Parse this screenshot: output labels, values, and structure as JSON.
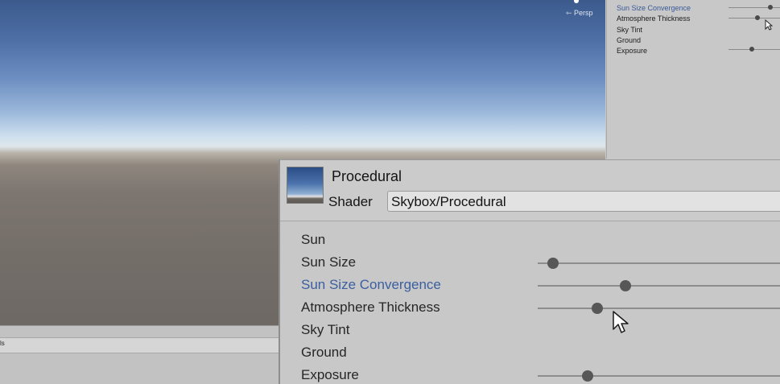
{
  "scene": {
    "persp_label": "⇽ Persp",
    "bottom_fragment": "ls"
  },
  "mini_inspector": {
    "items": [
      {
        "label": "Sun Size Convergence",
        "active": true,
        "slider_value": 0.82
      },
      {
        "label": "Atmosphere Thickness",
        "active": false,
        "slider_value": 0.56
      },
      {
        "label": "Sky Tint",
        "active": false,
        "slider_value": null
      },
      {
        "label": "Ground",
        "active": false,
        "slider_value": null
      },
      {
        "label": "Exposure",
        "active": false,
        "slider_value": 0.45
      }
    ]
  },
  "material": {
    "name": "Procedural",
    "shader_label": "Shader",
    "shader_value": "Skybox/Procedural"
  },
  "properties": [
    {
      "label": "Sun",
      "active": false,
      "slider_value": null
    },
    {
      "label": "Sun Size",
      "active": false,
      "slider_value": 0.06
    },
    {
      "label": "Sun Size Convergence",
      "active": true,
      "slider_value": 0.35
    },
    {
      "label": "Atmosphere Thickness",
      "active": false,
      "slider_value": 0.24
    },
    {
      "label": "Sky Tint",
      "active": false,
      "slider_value": null
    },
    {
      "label": "Ground",
      "active": false,
      "slider_value": null
    },
    {
      "label": "Exposure",
      "active": false,
      "slider_value": 0.2
    }
  ],
  "colors": {
    "active_label": "#3b5f9f",
    "panel_bg": "#c8c8c8",
    "knob": "#575757"
  }
}
